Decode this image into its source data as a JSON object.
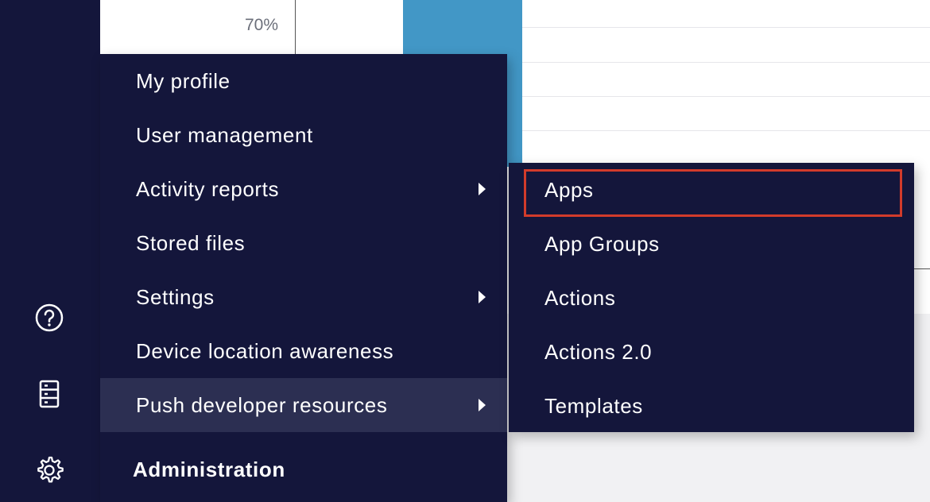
{
  "chart": {
    "y_tick_label": "70%",
    "bar_color": "#4297c6"
  },
  "sidebar": {
    "icons": [
      "help-icon",
      "storage-icon",
      "gear-icon"
    ],
    "background": "#14163b"
  },
  "menu": {
    "items": [
      {
        "label": "My profile",
        "has_submenu": false
      },
      {
        "label": "User management",
        "has_submenu": false
      },
      {
        "label": "Activity reports",
        "has_submenu": true
      },
      {
        "label": "Stored files",
        "has_submenu": false
      },
      {
        "label": "Settings",
        "has_submenu": true
      },
      {
        "label": "Device location awareness",
        "has_submenu": false
      },
      {
        "label": "Push developer resources",
        "has_submenu": true,
        "active": true
      }
    ],
    "section_label": "Administration"
  },
  "submenu": {
    "items": [
      {
        "label": "Apps",
        "highlighted": true
      },
      {
        "label": "App Groups"
      },
      {
        "label": "Actions"
      },
      {
        "label": "Actions 2.0"
      },
      {
        "label": "Templates"
      }
    ],
    "highlight_color": "#d23b2b"
  }
}
